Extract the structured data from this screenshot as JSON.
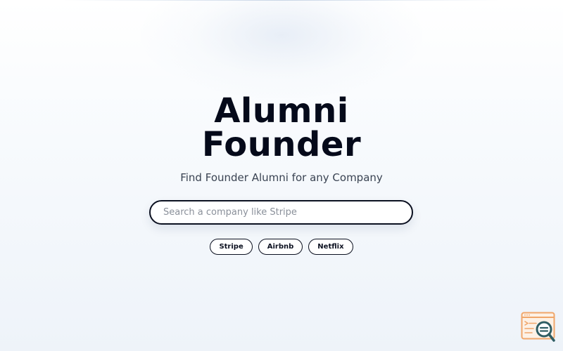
{
  "hero": {
    "title_line1": "Alumni",
    "title_line2": "Founder",
    "subtitle": "Find Founder Alumni for any Company"
  },
  "search": {
    "placeholder": "Search a company like Stripe",
    "value": ""
  },
  "suggestions": [
    {
      "label": "Stripe"
    },
    {
      "label": "Airbnb"
    },
    {
      "label": "Netflix"
    }
  ],
  "corner_badge": {
    "icon": "search-report-icon",
    "colors": {
      "frame": "#f0a66a",
      "lens": "#2f5d63"
    }
  }
}
